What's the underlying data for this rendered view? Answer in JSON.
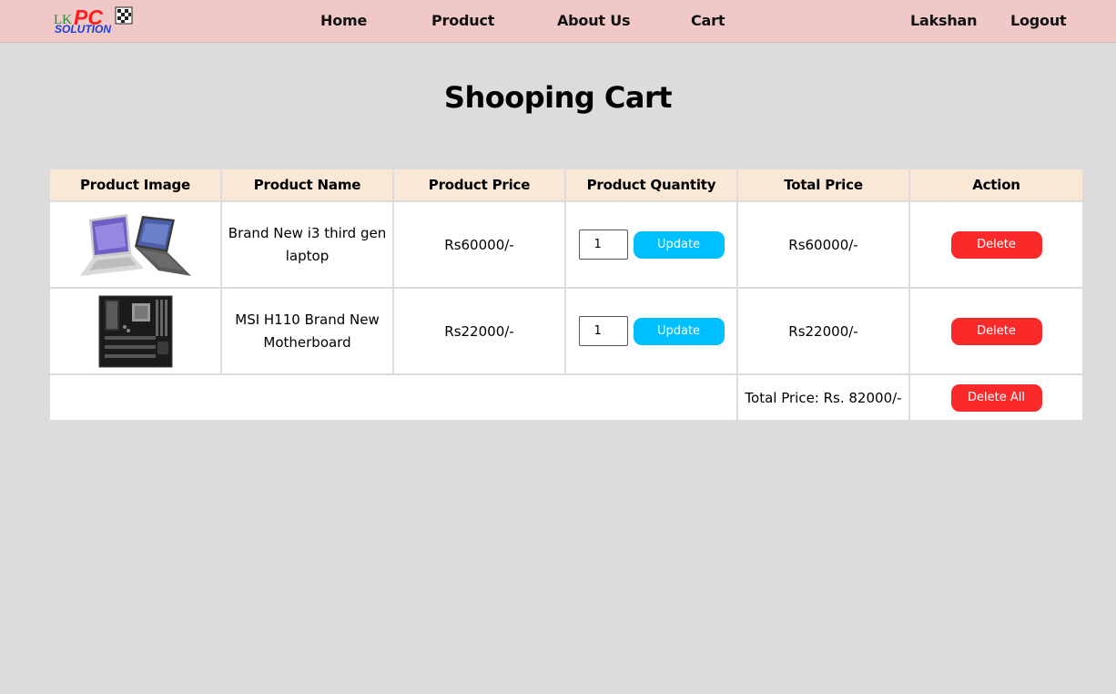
{
  "header": {
    "logo": {
      "text_lk": "LK",
      "text_pc": "PC",
      "text_solution": "SOLUTION"
    },
    "nav": [
      "Home",
      "Product",
      "About Us",
      "Cart"
    ],
    "user": "Lakshan",
    "logout": "Logout"
  },
  "page": {
    "title": "Shooping Cart"
  },
  "table": {
    "headers": [
      "Product Image",
      "Product Name",
      "Product Price",
      "Product Quantity",
      "Total Price",
      "Action"
    ],
    "rows": [
      {
        "image": "laptop-image",
        "name": "Brand New i3 third gen laptop",
        "price": "Rs60000/-",
        "quantity": "1",
        "update": "Update",
        "total": "Rs60000/-",
        "delete": "Delete"
      },
      {
        "image": "motherboard-image",
        "name": "MSI H110 Brand New Motherboard",
        "price": "Rs22000/-",
        "quantity": "1",
        "update": "Update",
        "total": "Rs22000/-",
        "delete": "Delete"
      }
    ],
    "footer": {
      "total": "Total Price: Rs. 82000/-",
      "delete_all": "Delete All"
    }
  },
  "colors": {
    "navbar": "#f0c8c8",
    "page_bg": "#dcdcdc",
    "header_bg": "#f9e8d6",
    "update": "#00bfff",
    "delete": "#fb2a2a"
  }
}
